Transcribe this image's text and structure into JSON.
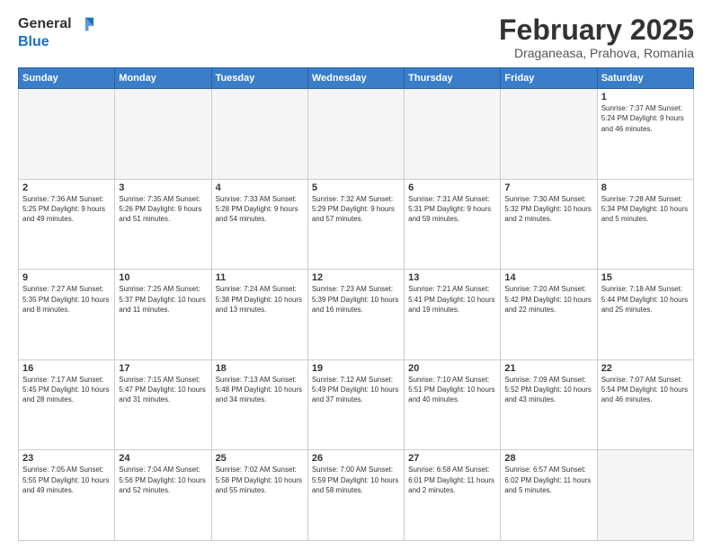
{
  "logo": {
    "general": "General",
    "blue": "Blue"
  },
  "header": {
    "month": "February 2025",
    "location": "Draganeasa, Prahova, Romania"
  },
  "weekdays": [
    "Sunday",
    "Monday",
    "Tuesday",
    "Wednesday",
    "Thursday",
    "Friday",
    "Saturday"
  ],
  "weeks": [
    [
      {
        "day": "",
        "info": ""
      },
      {
        "day": "",
        "info": ""
      },
      {
        "day": "",
        "info": ""
      },
      {
        "day": "",
        "info": ""
      },
      {
        "day": "",
        "info": ""
      },
      {
        "day": "",
        "info": ""
      },
      {
        "day": "1",
        "info": "Sunrise: 7:37 AM\nSunset: 5:24 PM\nDaylight: 9 hours\nand 46 minutes."
      }
    ],
    [
      {
        "day": "2",
        "info": "Sunrise: 7:36 AM\nSunset: 5:25 PM\nDaylight: 9 hours\nand 49 minutes."
      },
      {
        "day": "3",
        "info": "Sunrise: 7:35 AM\nSunset: 5:26 PM\nDaylight: 9 hours\nand 51 minutes."
      },
      {
        "day": "4",
        "info": "Sunrise: 7:33 AM\nSunset: 5:28 PM\nDaylight: 9 hours\nand 54 minutes."
      },
      {
        "day": "5",
        "info": "Sunrise: 7:32 AM\nSunset: 5:29 PM\nDaylight: 9 hours\nand 57 minutes."
      },
      {
        "day": "6",
        "info": "Sunrise: 7:31 AM\nSunset: 5:31 PM\nDaylight: 9 hours\nand 59 minutes."
      },
      {
        "day": "7",
        "info": "Sunrise: 7:30 AM\nSunset: 5:32 PM\nDaylight: 10 hours\nand 2 minutes."
      },
      {
        "day": "8",
        "info": "Sunrise: 7:28 AM\nSunset: 5:34 PM\nDaylight: 10 hours\nand 5 minutes."
      }
    ],
    [
      {
        "day": "9",
        "info": "Sunrise: 7:27 AM\nSunset: 5:35 PM\nDaylight: 10 hours\nand 8 minutes."
      },
      {
        "day": "10",
        "info": "Sunrise: 7:25 AM\nSunset: 5:37 PM\nDaylight: 10 hours\nand 11 minutes."
      },
      {
        "day": "11",
        "info": "Sunrise: 7:24 AM\nSunset: 5:38 PM\nDaylight: 10 hours\nand 13 minutes."
      },
      {
        "day": "12",
        "info": "Sunrise: 7:23 AM\nSunset: 5:39 PM\nDaylight: 10 hours\nand 16 minutes."
      },
      {
        "day": "13",
        "info": "Sunrise: 7:21 AM\nSunset: 5:41 PM\nDaylight: 10 hours\nand 19 minutes."
      },
      {
        "day": "14",
        "info": "Sunrise: 7:20 AM\nSunset: 5:42 PM\nDaylight: 10 hours\nand 22 minutes."
      },
      {
        "day": "15",
        "info": "Sunrise: 7:18 AM\nSunset: 5:44 PM\nDaylight: 10 hours\nand 25 minutes."
      }
    ],
    [
      {
        "day": "16",
        "info": "Sunrise: 7:17 AM\nSunset: 5:45 PM\nDaylight: 10 hours\nand 28 minutes."
      },
      {
        "day": "17",
        "info": "Sunrise: 7:15 AM\nSunset: 5:47 PM\nDaylight: 10 hours\nand 31 minutes."
      },
      {
        "day": "18",
        "info": "Sunrise: 7:13 AM\nSunset: 5:48 PM\nDaylight: 10 hours\nand 34 minutes."
      },
      {
        "day": "19",
        "info": "Sunrise: 7:12 AM\nSunset: 5:49 PM\nDaylight: 10 hours\nand 37 minutes."
      },
      {
        "day": "20",
        "info": "Sunrise: 7:10 AM\nSunset: 5:51 PM\nDaylight: 10 hours\nand 40 minutes."
      },
      {
        "day": "21",
        "info": "Sunrise: 7:09 AM\nSunset: 5:52 PM\nDaylight: 10 hours\nand 43 minutes."
      },
      {
        "day": "22",
        "info": "Sunrise: 7:07 AM\nSunset: 5:54 PM\nDaylight: 10 hours\nand 46 minutes."
      }
    ],
    [
      {
        "day": "23",
        "info": "Sunrise: 7:05 AM\nSunset: 5:55 PM\nDaylight: 10 hours\nand 49 minutes."
      },
      {
        "day": "24",
        "info": "Sunrise: 7:04 AM\nSunset: 5:56 PM\nDaylight: 10 hours\nand 52 minutes."
      },
      {
        "day": "25",
        "info": "Sunrise: 7:02 AM\nSunset: 5:58 PM\nDaylight: 10 hours\nand 55 minutes."
      },
      {
        "day": "26",
        "info": "Sunrise: 7:00 AM\nSunset: 5:59 PM\nDaylight: 10 hours\nand 58 minutes."
      },
      {
        "day": "27",
        "info": "Sunrise: 6:58 AM\nSunset: 6:01 PM\nDaylight: 11 hours\nand 2 minutes."
      },
      {
        "day": "28",
        "info": "Sunrise: 6:57 AM\nSunset: 6:02 PM\nDaylight: 11 hours\nand 5 minutes."
      },
      {
        "day": "",
        "info": ""
      }
    ]
  ]
}
